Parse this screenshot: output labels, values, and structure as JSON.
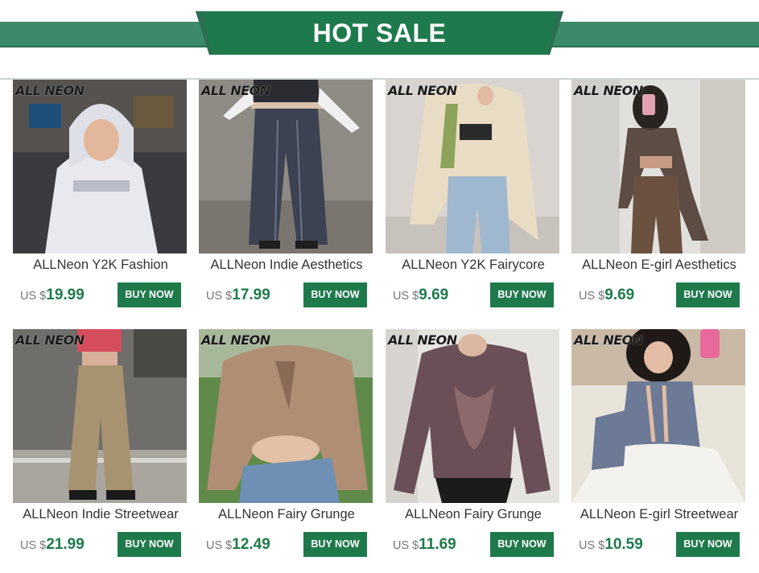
{
  "banner": {
    "title": "HOT SALE"
  },
  "colors": {
    "brand_green": "#1e7a4c",
    "banner_strip": "#3d8a6a",
    "button_bg": "#1f7a4b"
  },
  "products": [
    {
      "watermark": "ALL NEON",
      "name": "ALLNeon Y2K Fashion",
      "currency": "US $",
      "price": "19.99",
      "button": "BUY NOW"
    },
    {
      "watermark": "ALL NEON",
      "name": "ALLNeon Indie Aesthetics",
      "currency": "US $",
      "price": "17.99",
      "button": "BUY NOW"
    },
    {
      "watermark": "ALL NEON",
      "name": "ALLNeon Y2K Fairycore",
      "currency": "US $",
      "price": "9.69",
      "button": "BUY NOW"
    },
    {
      "watermark": "ALL NEON",
      "name": "ALLNeon E-girl Aesthetics",
      "currency": "US $",
      "price": "9.69",
      "button": "BUY NOW"
    },
    {
      "watermark": "ALL NEON",
      "name": "ALLNeon Indie Streetwear",
      "currency": "US $",
      "price": "21.99",
      "button": "BUY NOW"
    },
    {
      "watermark": "ALL NEON",
      "name": "ALLNeon Fairy Grunge",
      "currency": "US $",
      "price": "12.49",
      "button": "BUY NOW"
    },
    {
      "watermark": "ALL NEON",
      "name": "ALLNeon Fairy Grunge",
      "currency": "US $",
      "price": "11.69",
      "button": "BUY NOW"
    },
    {
      "watermark": "ALL NEON",
      "name": "ALLNeon E-girl Streetwear",
      "currency": "US $",
      "price": "10.59",
      "button": "BUY NOW"
    }
  ]
}
